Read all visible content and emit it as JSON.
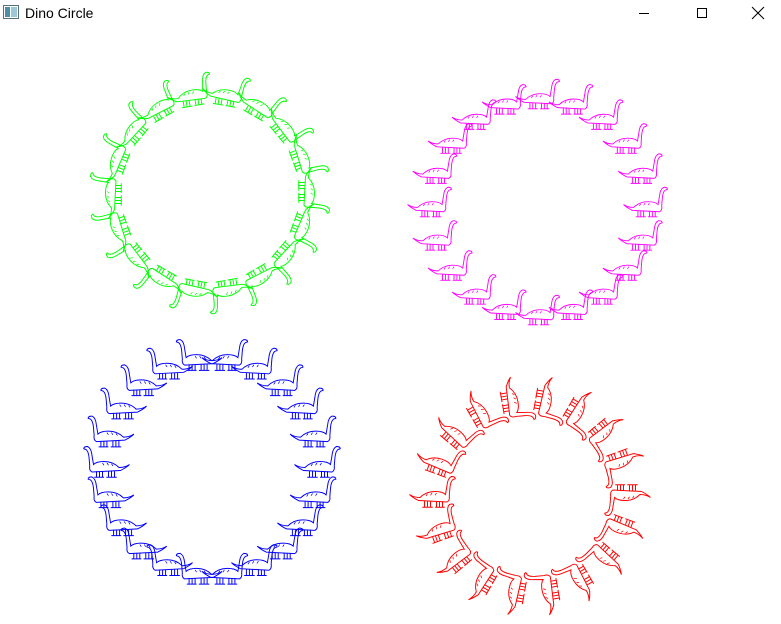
{
  "window": {
    "title": "Dino Circle",
    "controls": {
      "minimize": "minimize-icon",
      "maximize": "maximize-icon",
      "close": "close-icon"
    }
  },
  "rings": [
    {
      "name": "green-dino-ring",
      "color": "#00ff00",
      "count": 18,
      "orientation": "radial-outward"
    },
    {
      "name": "magenta-dino-ring",
      "color": "#ff00ff",
      "count": 20,
      "orientation": "upright"
    },
    {
      "name": "blue-dino-ring",
      "color": "#0000ff",
      "count": 22,
      "orientation": "upright-mirrored"
    },
    {
      "name": "red-dino-ring",
      "color": "#ff0000",
      "count": 18,
      "orientation": "tangential"
    }
  ]
}
